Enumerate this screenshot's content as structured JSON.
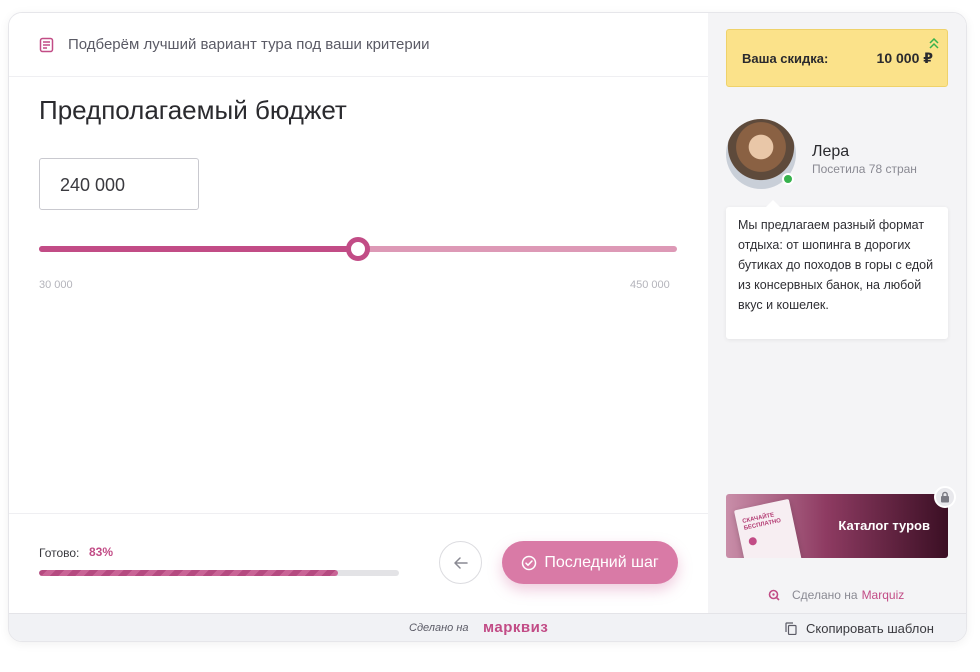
{
  "header": {
    "subtitle": "Подберём лучший вариант тура под ваши критерии"
  },
  "question": {
    "title": "Предполагаемый бюджет"
  },
  "budget": {
    "value": "240 000",
    "min_label": "30 000",
    "max_label": "450 000",
    "slider_fraction": 0.5
  },
  "progress": {
    "label": "Готово:",
    "value": "83%",
    "fraction": 0.83
  },
  "nav": {
    "next_label": "Последний шаг"
  },
  "sidebar": {
    "discount_label": "Ваша скидка:",
    "discount_value": "10 000 ₽",
    "agent": {
      "name": "Лера",
      "subtitle": "Посетила 78 стран",
      "online": true
    },
    "message": "Мы предлагаем разный формат отдыха: от шопинга в дорогих бутиках до походов в горы с едой из консервных банок, на любой вкус и кошелек.",
    "catalog_label": "Каталог туров",
    "catalog_book_text": "СКАЧАЙТЕ БЕСПЛАТНО",
    "made_on": "Сделано на",
    "made_on_brand": "Marquiz"
  },
  "bottom": {
    "made_on": "Сделано на",
    "brand": "марквиз",
    "copy_label": "Скопировать шаблон"
  },
  "colors": {
    "accent": "#c24c86",
    "accent_light": "#dd99b6",
    "next_button": "#d97aa6",
    "discount_bg": "#fbe28a",
    "online": "#37b24d"
  },
  "icons": {
    "header": "checklist-icon",
    "back": "arrow-left-icon",
    "next": "check-circle-icon",
    "discount": "double-chevron-up-icon",
    "lock": "lock-icon",
    "made_on": "marquiz-logo-icon",
    "copy": "copy-icon"
  }
}
